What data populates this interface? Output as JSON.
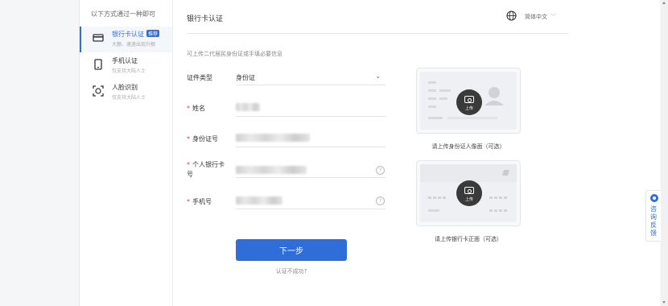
{
  "sidebar": {
    "hint": "以下方式通过一种即可",
    "items": [
      {
        "title": "银行卡认证",
        "badge": "推荐",
        "sub": "大额、速速出现升额",
        "icon": "bank-card-icon"
      },
      {
        "title": "手机认证",
        "sub": "仅支持大陆人士",
        "icon": "mobile-phone-icon"
      },
      {
        "title": "人脸识别",
        "sub": "仅支持大陆人士",
        "icon": "face-scan-icon"
      }
    ]
  },
  "header": {
    "title": "银行卡认证",
    "language": "简体中文",
    "language_icon": "globe-icon"
  },
  "form": {
    "tip": "可上传二代居民身份证或手填必要信息",
    "id_type_label": "证件类型",
    "id_type_value": "身份证",
    "name_label": "姓名",
    "id_number_label": "身份证号",
    "bank_card_label_line1": "个人银行卡",
    "bank_card_label_line2": "号",
    "phone_label": "手机号",
    "help_glyph": "?",
    "next_button": "下一步",
    "fail_link": "认证不成功?"
  },
  "upload": {
    "cam_text": "上传",
    "id_caption": "请上传身份证人像面（可选）",
    "bank_caption": "请上传银行卡正面（可选）"
  },
  "feedback": {
    "label": "咨询反馈"
  },
  "colors": {
    "accent": "#2f6ed8",
    "required": "#e4393c"
  }
}
